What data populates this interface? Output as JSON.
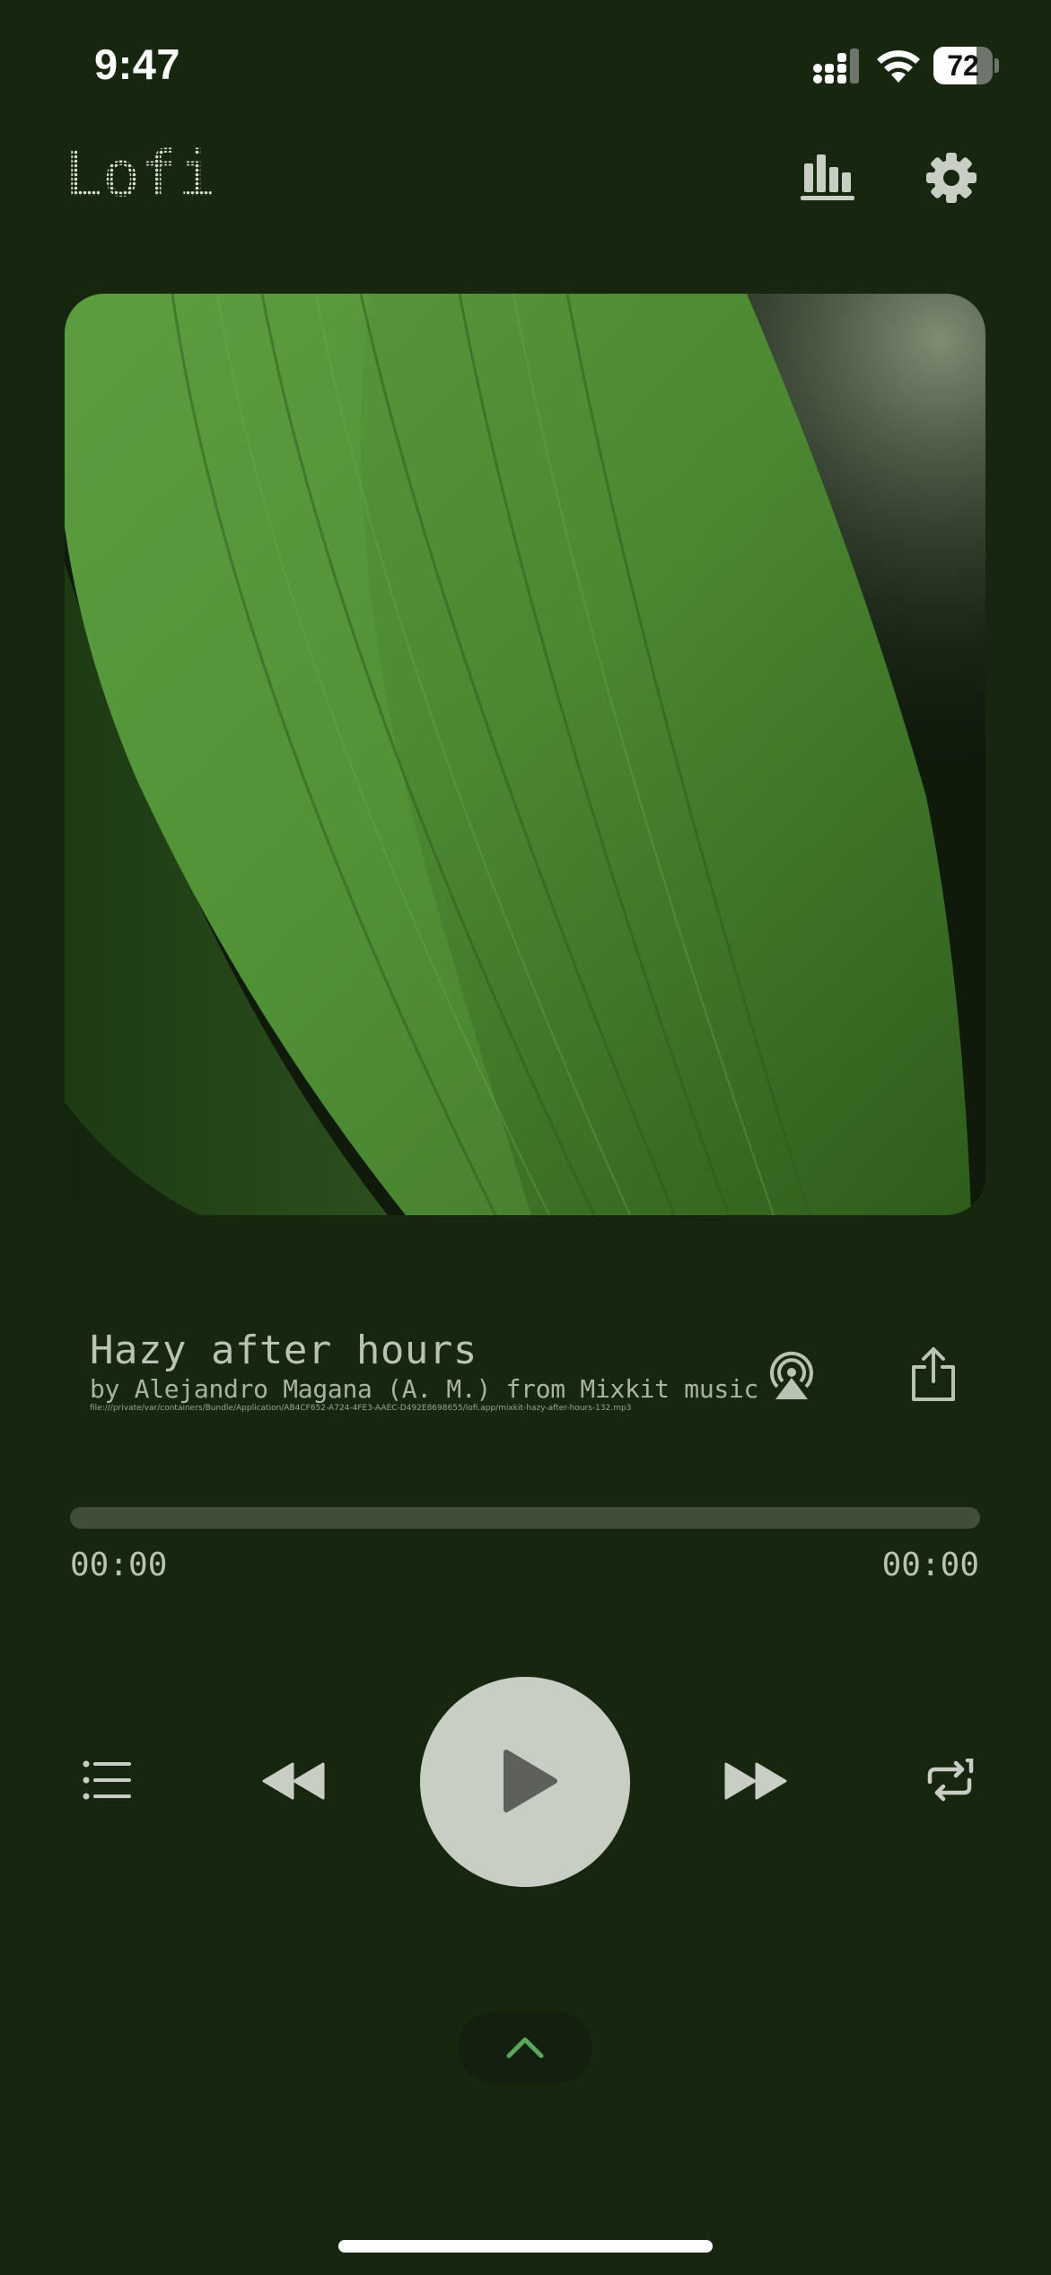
{
  "status_bar": {
    "time": "9:47",
    "battery_level": "72",
    "battery_fraction": 0.72,
    "signal_icon": "cellular-signal-icon",
    "wifi_icon": "wifi-icon"
  },
  "header": {
    "logo_text": "Lofi.",
    "equalizer_icon": "equalizer-icon",
    "settings_icon": "gear-icon"
  },
  "track": {
    "title": "Hazy after hours",
    "artist_line": "by Alejandro Magana (A. M.) from Mixkit music",
    "file_path": "file:///private/var/containers/Bundle/Application/AB4CF652-A724-4FE3-AAEC-D492E8698655/lofi.app/mixkit-hazy-after-hours-132.mp3",
    "airplay_icon": "airplay-icon",
    "share_icon": "share-icon"
  },
  "playback": {
    "progress_fraction": 0,
    "elapsed": "00:00",
    "duration": "00:00"
  },
  "controls": {
    "queue_icon": "list-icon",
    "rewind_icon": "rewind-icon",
    "play_icon": "play-icon",
    "forward_icon": "fast-forward-icon",
    "repeat_icon": "repeat-one-icon",
    "expand_icon": "chevron-up-icon"
  },
  "colors": {
    "background": "#17260f",
    "control_fill": "#c8cec4",
    "progress_track": "#3f4d39",
    "accent_green": "#5aa65f"
  }
}
